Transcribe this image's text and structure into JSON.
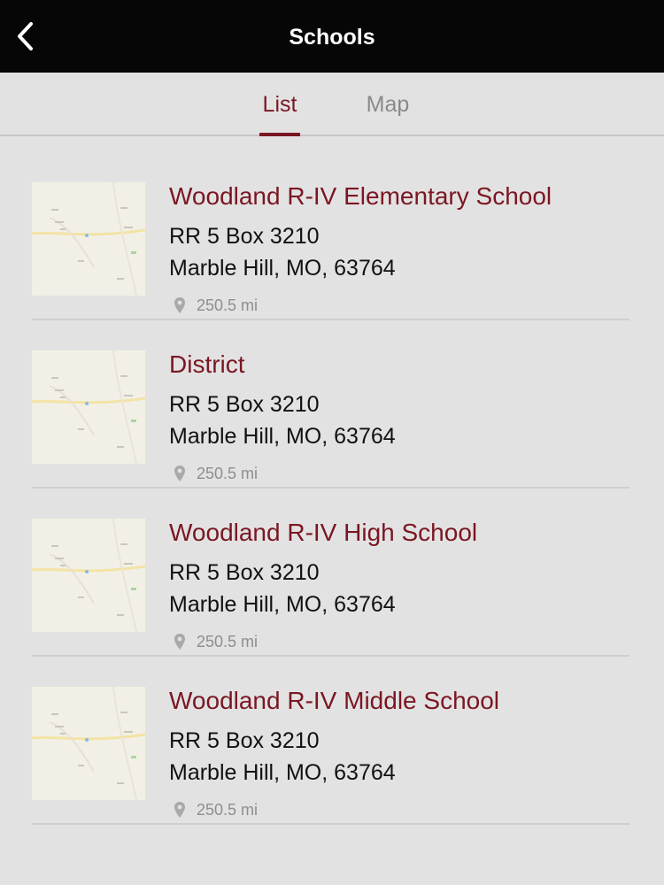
{
  "header": {
    "title": "Schools",
    "back_icon": "chevron-left-icon"
  },
  "tabs": [
    {
      "label": "List",
      "active": true
    },
    {
      "label": "Map",
      "active": false
    }
  ],
  "colors": {
    "accent": "#7a1722",
    "header_bg": "#060606",
    "background": "#e3e2e3",
    "muted": "#8e8e8e"
  },
  "schools": [
    {
      "name": "Woodland R-IV Elementary School",
      "address_line1": "RR 5 Box 3210",
      "address_line2": "Marble Hill, MO, 63764",
      "distance": "250.5 mi",
      "thumbnail": "map-thumbnail"
    },
    {
      "name": "District",
      "address_line1": "RR 5 Box 3210",
      "address_line2": "Marble Hill, MO, 63764",
      "distance": "250.5 mi",
      "thumbnail": "map-thumbnail"
    },
    {
      "name": "Woodland R-IV High School",
      "address_line1": "RR 5 Box 3210",
      "address_line2": "Marble Hill, MO, 63764",
      "distance": "250.5 mi",
      "thumbnail": "map-thumbnail"
    },
    {
      "name": "Woodland R-IV Middle School",
      "address_line1": "RR 5 Box 3210",
      "address_line2": "Marble Hill, MO, 63764",
      "distance": "250.5 mi",
      "thumbnail": "map-thumbnail"
    }
  ]
}
